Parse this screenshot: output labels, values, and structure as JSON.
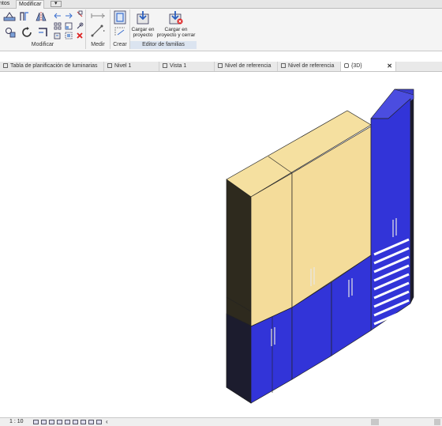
{
  "ribbon": {
    "tabs": [
      "ntos",
      "Modificar"
    ],
    "active_tab": "Modificar",
    "extra_dropdown": "▾",
    "panels": {
      "modificar": "Modificar",
      "medir": "Medir",
      "crear": "Crear",
      "editor_familias": "Editor de familias"
    },
    "buttons": {
      "cargar_proyecto_1": "Cargar en",
      "cargar_proyecto_2": "proyecto",
      "cargar_cerrar_1": "Cargar en",
      "cargar_cerrar_2": "proyecto y cerrar"
    }
  },
  "view_tabs": [
    {
      "label": "Tabla de planificación de luminarias"
    },
    {
      "label": "Nivel 1"
    },
    {
      "label": "Vista 1"
    },
    {
      "label": "Nivel de referencia"
    },
    {
      "label": "Nivel de referencia"
    },
    {
      "label": "{3D}"
    }
  ],
  "active_view": "{3D}",
  "status": {
    "scale": "1 : 10",
    "collapse": "‹"
  },
  "colors": {
    "cabinet_top": "#f5e0a0",
    "cabinet_front": "#f4dc9a",
    "cabinet_dark": "#2e2a1e",
    "blue_door": "#3234d8",
    "blue_top": "#3a3ccf",
    "dark_side": "#1c1c2e"
  }
}
